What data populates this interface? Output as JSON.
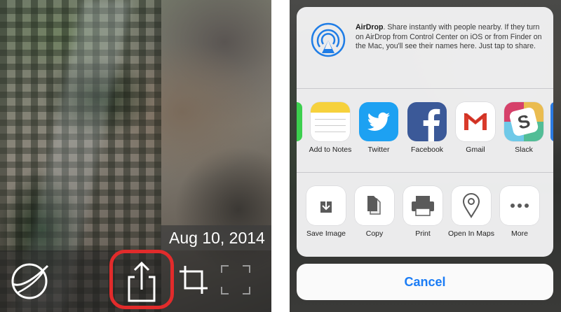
{
  "left_panel": {
    "date_label": "Aug 10, 2014",
    "toolbar": {
      "globe_icon": "globe-icon",
      "share_icon": "share-icon",
      "crop_icon": "crop-icon",
      "expand_icon": "expand-icon"
    },
    "highlight_color": "#e22b2b"
  },
  "share_sheet": {
    "airdrop": {
      "title": "AirDrop",
      "description": ". Share instantly with people nearby. If they turn on AirDrop from Control Center on iOS or from Finder on the Mac, you'll see their names here. Just tap to share.",
      "icon": "airdrop-icon"
    },
    "apps": [
      {
        "label": "Add to Notes",
        "icon": "notes-icon"
      },
      {
        "label": "Twitter",
        "icon": "twitter-icon"
      },
      {
        "label": "Facebook",
        "icon": "facebook-icon"
      },
      {
        "label": "Gmail",
        "icon": "gmail-icon"
      },
      {
        "label": "Slack",
        "icon": "slack-icon"
      }
    ],
    "actions": [
      {
        "label": "Save Image",
        "icon": "save-image-icon"
      },
      {
        "label": "Copy",
        "icon": "copy-icon"
      },
      {
        "label": "Print",
        "icon": "print-icon"
      },
      {
        "label": "Open In Maps",
        "icon": "map-pin-icon"
      },
      {
        "label": "More",
        "icon": "more-icon"
      }
    ],
    "cancel_label": "Cancel"
  },
  "colors": {
    "accent": "#1a7cf5",
    "twitter": "#1da1f2",
    "facebook": "#3b5998",
    "notes": "#f6d13c"
  }
}
